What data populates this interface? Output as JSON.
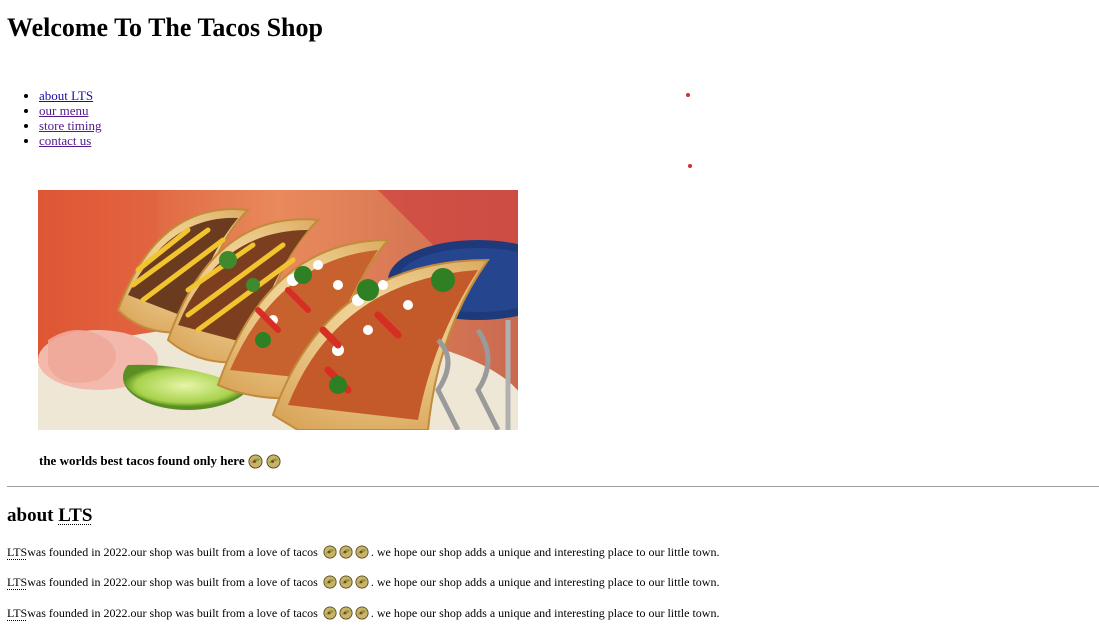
{
  "header": {
    "title": "Welcome To The Tacos Shop"
  },
  "nav": {
    "items": [
      {
        "label": "about LTS",
        "visited": false
      },
      {
        "label": "our menu",
        "visited": true
      },
      {
        "label": "store timing",
        "visited": true
      },
      {
        "label": "contact us",
        "visited": true
      }
    ]
  },
  "hero": {
    "image": "tacos-photo",
    "tagline": "the worlds best tacos found only here",
    "tagline_emojis": [
      "taco-icon",
      "taco-icon"
    ]
  },
  "about": {
    "heading_prefix": "about ",
    "heading_abbr": "LTS",
    "paragraph_abbr": "LTS",
    "paragraph_text_before": "was founded in 2022.our shop was built from a love of tacos",
    "paragraph_text_after": ". we hope our shop adds a unique and interesting place to our little town.",
    "paragraph_emojis": [
      "taco-icon",
      "taco-icon",
      "taco-icon"
    ],
    "paragraph_count": 3
  },
  "colors": {
    "link": "#1a0dab",
    "visited_link": "#52188c",
    "decorative_bullet": "#d32f2f",
    "divider": "#9e9e9e"
  }
}
